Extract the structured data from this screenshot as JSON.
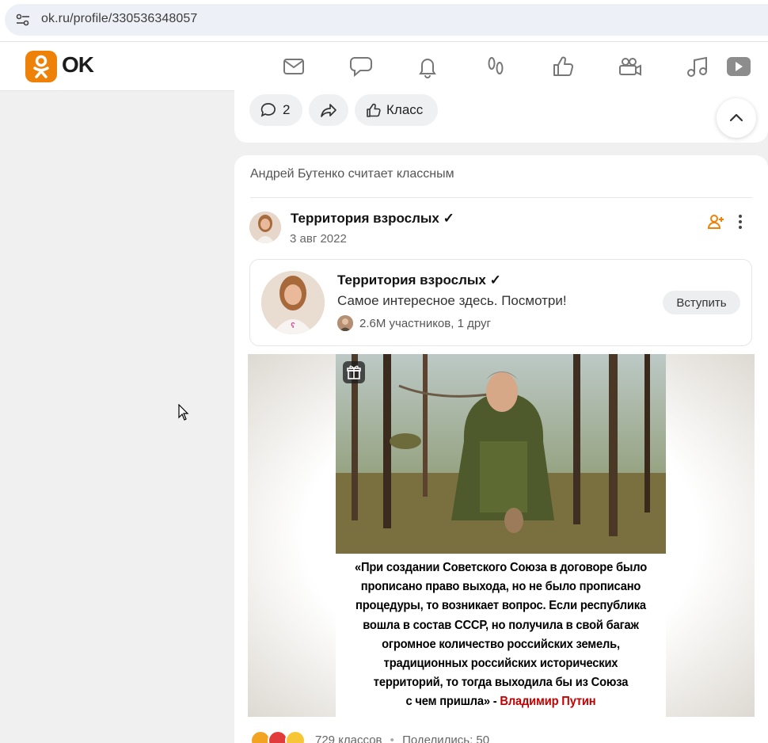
{
  "browser": {
    "url": "ok.ru/profile/330536348057"
  },
  "header": {
    "logo_text": "OK",
    "brand_color": "#ee8208",
    "nav_icons": [
      "mail-icon",
      "discussions-icon",
      "notifications-icon",
      "guests-icon",
      "likes-icon",
      "video-calls-icon",
      "music-icon",
      "video-icon"
    ]
  },
  "prev_post": {
    "comments_count": "2",
    "like_label": "Класс"
  },
  "post": {
    "action_text": "Андрей Бутенко считает классным",
    "author": "Территория взрослых ✓",
    "date": "3 авг 2022",
    "group_card": {
      "title": "Территория взрослых ✓",
      "description": "Самое интересное здесь. Посмотри!",
      "members": "2.6M участников, 1 друг",
      "join_label": "Вступить"
    },
    "image_quote": {
      "lines": [
        "«При создании Советского Союза в договоре было",
        "прописано право выхода, но не было прописано",
        "процедуры, то возникает вопрос. Если республика",
        "вошла в состав СССР, но получила в свой багаж",
        "огромное количество российских земель,",
        "традиционных российских исторических",
        "территорий, то тогда выходила бы из Союза",
        "с чем пришла» -"
      ],
      "author": "Владимир Путин"
    },
    "stats": {
      "likes": "729 классов",
      "separator": "•",
      "shares": "Поделились: 50"
    }
  }
}
